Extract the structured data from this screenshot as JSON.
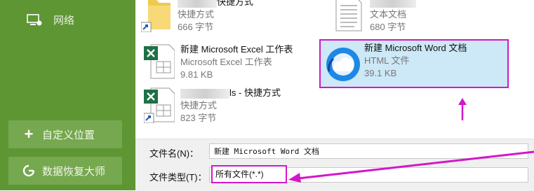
{
  "sidebar": {
    "network_label": "网络",
    "custom_location_label": "自定义位置",
    "data_recovery_label": "数据恢复大师"
  },
  "files": [
    {
      "name_tail": "快捷方式",
      "type": "快捷方式",
      "size": "666 字节",
      "icon": "folder-shortcut-icon"
    },
    {
      "name_tail": "",
      "type": "文本文档",
      "size": "680 字节",
      "icon": "text-document-icon"
    },
    {
      "name": "新建 Microsoft Excel 工作表",
      "type": "Microsoft Excel 工作表",
      "size": "9.81 KB",
      "icon": "excel-icon"
    },
    {
      "name": "新建 Microsoft Word 文档",
      "type": "HTML 文件",
      "size": "39.1 KB",
      "icon": "edge-browser-icon",
      "selected": true
    },
    {
      "name_tail": "ls - 快捷方式",
      "type": "快捷方式",
      "size": "823 字节",
      "icon": "excel-shortcut-icon"
    }
  ],
  "save_dialog": {
    "filename_label": "文件名(N)：",
    "filename_value": "新建 Microsoft Word 文档",
    "filetype_label": "文件类型(T)：",
    "filetype_value": "所有文件(*.*)"
  },
  "colors": {
    "sidebar_bg": "#5e9634",
    "sidebar_item_bg": "#76a84f",
    "highlight": "#d218c8",
    "selection_bg": "#cde8f7",
    "excel_green": "#1e7145",
    "folder_yellow": "#f2c94c"
  }
}
